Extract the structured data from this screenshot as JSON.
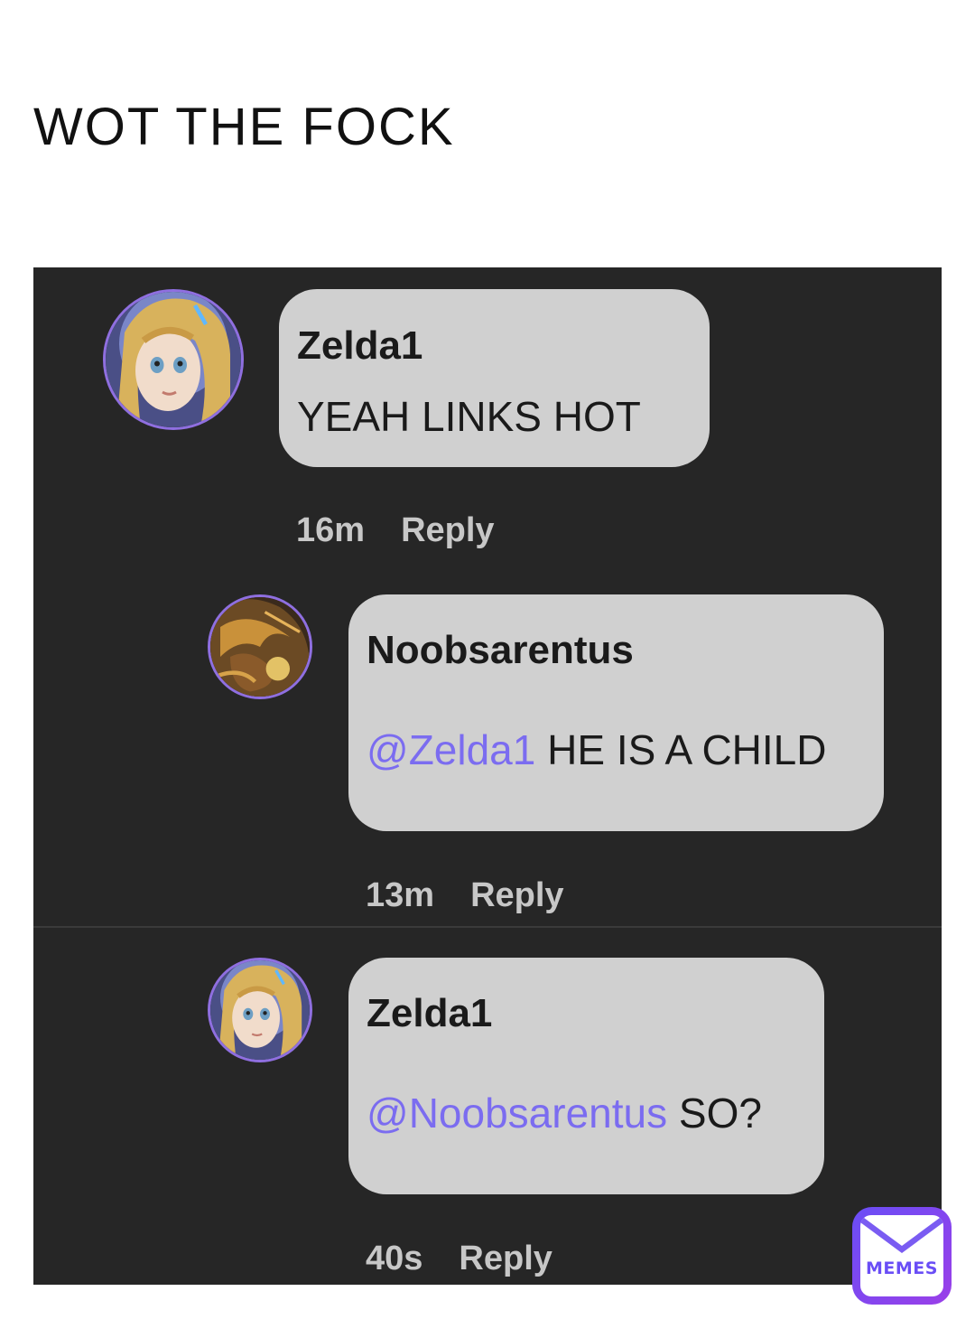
{
  "post": {
    "caption": "WOT THE FOCK"
  },
  "comments": [
    {
      "username": "Zelda1",
      "mention": "",
      "text": "YEAH LINKS HOT",
      "time": "16m",
      "reply_label": "Reply",
      "avatar": "zelda-avatar-icon"
    },
    {
      "username": "Noobsarentus",
      "mention": "@Zelda1",
      "text": " HE IS A CHILD",
      "time": "13m",
      "reply_label": "Reply",
      "avatar": "link-avatar-icon"
    },
    {
      "username": "Zelda1",
      "mention": "@Noobsarentus",
      "text": " SO?",
      "time": "40s",
      "reply_label": "Reply",
      "avatar": "zelda-avatar-icon"
    }
  ],
  "watermark": {
    "label": "MEMES",
    "icon": "envelope-icon"
  },
  "colors": {
    "panel_bg": "#262626",
    "bubble_bg": "#d0d0d0",
    "mention": "#7b6cf0",
    "avatar_ring": "#8f6fe0",
    "meta_text": "#c7c7c7",
    "logo_gradient_start": "#6a4ef6",
    "logo_gradient_end": "#9a3fe8"
  }
}
